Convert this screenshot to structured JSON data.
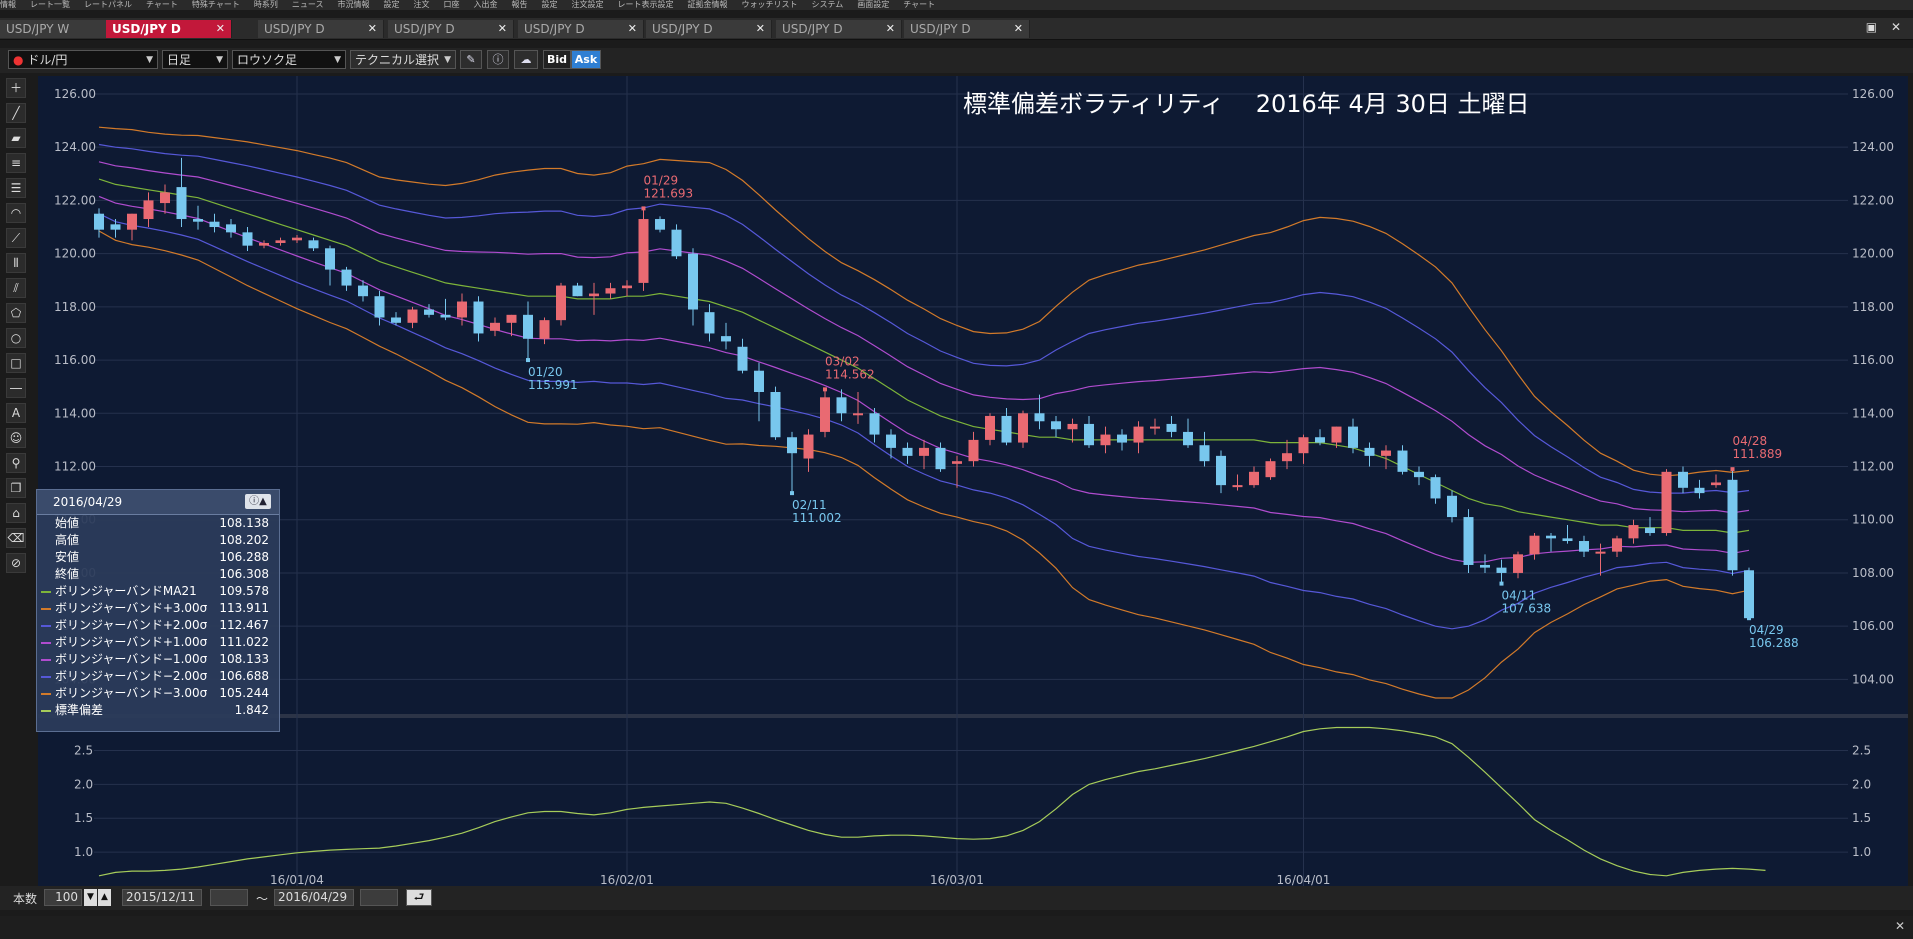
{
  "menubar": {
    "items": [
      "情報",
      "レート一覧",
      "レートパネル",
      "チャート",
      "特殊チャート",
      "時系列",
      "ニュース",
      "市況情報",
      "設定",
      "注文",
      "口座",
      "入出金",
      "報告",
      "設定",
      "注文設定",
      "レート表示設定",
      "証拠金情報",
      "ウォッチリスト",
      "システム",
      "画面設定",
      "チャート"
    ]
  },
  "tabs": [
    {
      "label": "USD/JPY W",
      "active": false
    },
    {
      "label": "USD/JPY D",
      "active": true
    },
    {
      "label": "USD/JPY D",
      "active": false
    },
    {
      "label": "USD/JPY D",
      "active": false
    },
    {
      "label": "USD/JPY D",
      "active": false
    },
    {
      "label": "USD/JPY D",
      "active": false
    },
    {
      "label": "USD/JPY D",
      "active": false
    },
    {
      "label": "USD/JPY D",
      "active": false
    }
  ],
  "toolbar": {
    "pair": "ドル/円",
    "period": "日足",
    "chart_type": "ロウソク足",
    "technical": "テクニカル選択",
    "bid": "Bid",
    "ask": "Ask"
  },
  "colors": {
    "up": "#e96a72",
    "down": "#78c7ee",
    "ma": "#7db43a",
    "band3": "#d27a2a",
    "band2": "#5658d8",
    "band1": "#b04ccf",
    "sd": "#a6cc5a",
    "bg": "#0e1a33"
  },
  "chart_data": {
    "type": "candlestick",
    "title": "標準偏差ボラティリティ　 2016年 4月 30日 土曜日",
    "y_ticks": [
      "126.00",
      "124.00",
      "122.00",
      "120.00",
      "118.00",
      "116.00",
      "114.00",
      "112.00",
      "110.00",
      "108.00",
      "106.00",
      "104.00"
    ],
    "sub_ticks": [
      "2.5",
      "2.0",
      "1.5",
      "1.0"
    ],
    "x_ticks": [
      "16/01/04",
      "16/02/01",
      "16/03/01",
      "16/04/01"
    ],
    "ohlc": [
      [
        121.5,
        121.7,
        120.6,
        120.9
      ],
      [
        121.1,
        121.3,
        120.6,
        120.9
      ],
      [
        120.9,
        121.5,
        120.5,
        121.5
      ],
      [
        121.3,
        122.3,
        121.0,
        122.0
      ],
      [
        121.9,
        122.6,
        121.5,
        122.3
      ],
      [
        122.5,
        123.6,
        121.0,
        121.3
      ],
      [
        121.3,
        121.8,
        120.9,
        121.2
      ],
      [
        121.2,
        121.5,
        120.8,
        121.0
      ],
      [
        121.1,
        121.3,
        120.6,
        120.8
      ],
      [
        120.8,
        121.0,
        120.1,
        120.3
      ],
      [
        120.3,
        120.5,
        120.2,
        120.4
      ],
      [
        120.4,
        120.6,
        120.3,
        120.5
      ],
      [
        120.5,
        120.7,
        120.4,
        120.6
      ],
      [
        120.5,
        120.6,
        120.1,
        120.2
      ],
      [
        120.2,
        120.3,
        118.8,
        119.4
      ],
      [
        119.4,
        119.5,
        118.6,
        118.8
      ],
      [
        118.8,
        119.0,
        118.2,
        118.4
      ],
      [
        118.4,
        118.6,
        117.3,
        117.6
      ],
      [
        117.6,
        117.8,
        117.3,
        117.4
      ],
      [
        117.4,
        118.0,
        117.2,
        117.9
      ],
      [
        117.9,
        118.1,
        117.6,
        117.7
      ],
      [
        117.7,
        118.3,
        117.5,
        117.6
      ],
      [
        117.6,
        118.5,
        117.3,
        118.2
      ],
      [
        118.2,
        118.4,
        116.7,
        117.0
      ],
      [
        117.1,
        117.6,
        116.9,
        117.4
      ],
      [
        117.4,
        117.7,
        116.9,
        117.7
      ],
      [
        117.7,
        118.2,
        116.0,
        116.8
      ],
      [
        116.8,
        117.6,
        116.6,
        117.5
      ],
      [
        117.5,
        118.9,
        117.3,
        118.8
      ],
      [
        118.8,
        118.9,
        118.4,
        118.4
      ],
      [
        118.4,
        118.9,
        117.7,
        118.5
      ],
      [
        118.5,
        118.9,
        118.3,
        118.7
      ],
      [
        118.7,
        119.0,
        118.4,
        118.8
      ],
      [
        118.9,
        121.7,
        118.6,
        121.3
      ],
      [
        121.3,
        121.4,
        120.8,
        120.9
      ],
      [
        120.9,
        121.1,
        119.8,
        119.9
      ],
      [
        120.0,
        120.2,
        117.3,
        117.9
      ],
      [
        117.8,
        118.1,
        116.7,
        117.0
      ],
      [
        116.9,
        117.4,
        116.4,
        116.7
      ],
      [
        116.5,
        116.8,
        115.5,
        115.6
      ],
      [
        115.6,
        115.9,
        113.7,
        114.8
      ],
      [
        114.8,
        115.0,
        113.0,
        113.1
      ],
      [
        113.1,
        113.3,
        111.0,
        112.5
      ],
      [
        112.3,
        113.4,
        111.8,
        113.2
      ],
      [
        113.3,
        114.9,
        113.1,
        114.6
      ],
      [
        114.6,
        114.9,
        113.7,
        114.0
      ],
      [
        114.0,
        114.8,
        113.6,
        114.0
      ],
      [
        114.0,
        114.2,
        112.9,
        113.2
      ],
      [
        113.2,
        113.4,
        112.3,
        112.7
      ],
      [
        112.7,
        112.9,
        112.1,
        112.4
      ],
      [
        112.4,
        113.0,
        111.9,
        112.7
      ],
      [
        112.7,
        112.9,
        111.8,
        111.9
      ],
      [
        112.1,
        112.4,
        111.2,
        112.2
      ],
      [
        112.2,
        113.3,
        112.0,
        113.0
      ],
      [
        113.0,
        114.0,
        112.8,
        113.9
      ],
      [
        113.9,
        114.2,
        112.8,
        112.9
      ],
      [
        112.9,
        114.1,
        112.7,
        114.0
      ],
      [
        114.0,
        114.7,
        113.4,
        113.7
      ],
      [
        113.7,
        113.9,
        113.1,
        113.4
      ],
      [
        113.4,
        113.8,
        112.9,
        113.6
      ],
      [
        113.6,
        113.9,
        112.7,
        112.8
      ],
      [
        112.8,
        113.5,
        112.5,
        113.2
      ],
      [
        113.2,
        113.4,
        112.6,
        112.9
      ],
      [
        112.9,
        113.7,
        112.5,
        113.5
      ],
      [
        113.5,
        113.8,
        113.2,
        113.5
      ],
      [
        113.6,
        113.9,
        113.1,
        113.3
      ],
      [
        113.3,
        113.8,
        112.7,
        112.8
      ],
      [
        112.8,
        113.3,
        112.0,
        112.2
      ],
      [
        112.4,
        112.6,
        111.0,
        111.3
      ],
      [
        111.3,
        111.7,
        111.1,
        111.3
      ],
      [
        111.3,
        112.0,
        111.2,
        111.8
      ],
      [
        111.6,
        112.3,
        111.5,
        112.2
      ],
      [
        112.2,
        113.0,
        111.9,
        112.5
      ],
      [
        112.5,
        113.2,
        112.1,
        113.1
      ],
      [
        113.1,
        113.4,
        112.8,
        112.9
      ],
      [
        112.9,
        113.5,
        112.7,
        113.5
      ],
      [
        113.5,
        113.8,
        112.5,
        112.7
      ],
      [
        112.7,
        112.9,
        112.0,
        112.4
      ],
      [
        112.4,
        112.8,
        111.9,
        112.6
      ],
      [
        112.6,
        112.8,
        111.7,
        111.8
      ],
      [
        111.8,
        112.0,
        111.3,
        111.6
      ],
      [
        111.6,
        111.7,
        110.6,
        110.8
      ],
      [
        110.9,
        111.1,
        109.9,
        110.1
      ],
      [
        110.1,
        110.4,
        108.0,
        108.3
      ],
      [
        108.3,
        108.7,
        108.0,
        108.2
      ],
      [
        108.2,
        108.5,
        107.6,
        108.0
      ],
      [
        108.0,
        108.8,
        107.8,
        108.7
      ],
      [
        108.7,
        109.5,
        108.5,
        109.4
      ],
      [
        109.4,
        109.5,
        108.8,
        109.3
      ],
      [
        109.3,
        109.8,
        109.1,
        109.2
      ],
      [
        109.2,
        109.4,
        108.6,
        108.8
      ],
      [
        108.8,
        109.1,
        107.9,
        108.8
      ],
      [
        108.8,
        109.4,
        108.6,
        109.3
      ],
      [
        109.3,
        110.0,
        109.1,
        109.8
      ],
      [
        109.7,
        110.1,
        109.4,
        109.5
      ],
      [
        109.5,
        111.9,
        109.4,
        111.8
      ],
      [
        111.8,
        112.0,
        111.0,
        111.2
      ],
      [
        111.2,
        111.5,
        110.8,
        111.0
      ],
      [
        111.3,
        111.7,
        111.2,
        111.4
      ],
      [
        111.5,
        111.9,
        107.9,
        108.1
      ],
      [
        108.1,
        108.2,
        106.3,
        106.3
      ]
    ],
    "ma21": [
      122.8,
      122.6,
      122.5,
      122.4,
      122.3,
      122.2,
      122.1,
      121.9,
      121.7,
      121.5,
      121.3,
      121.1,
      120.9,
      120.7,
      120.5,
      120.3,
      120.0,
      119.7,
      119.5,
      119.3,
      119.1,
      118.9,
      118.8,
      118.7,
      118.6,
      118.5,
      118.4,
      118.4,
      118.4,
      118.3,
      118.3,
      118.3,
      118.4,
      118.4,
      118.5,
      118.4,
      118.3,
      118.2,
      118.0,
      117.8,
      117.5,
      117.2,
      116.9,
      116.6,
      116.3,
      116.0,
      115.7,
      115.3,
      114.9,
      114.5,
      114.2,
      113.9,
      113.7,
      113.5,
      113.4,
      113.3,
      113.2,
      113.1,
      113.1,
      113.0,
      113.0,
      113.0,
      113.0,
      113.0,
      113.0,
      113.0,
      113.0,
      113.0,
      113.0,
      113.0,
      113.0,
      112.9,
      112.9,
      112.9,
      112.9,
      112.8,
      112.7,
      112.5,
      112.3,
      112.0,
      111.7,
      111.4,
      111.1,
      110.8,
      110.6,
      110.5,
      110.3,
      110.2,
      110.1,
      110.0,
      109.9,
      109.8,
      109.8,
      109.7,
      109.7,
      109.7,
      109.6,
      109.6,
      109.6,
      109.5,
      109.6
    ],
    "sd": [
      0.65,
      0.7,
      0.72,
      0.72,
      0.73,
      0.75,
      0.78,
      0.82,
      0.86,
      0.9,
      0.93,
      0.96,
      0.99,
      1.01,
      1.03,
      1.04,
      1.05,
      1.06,
      1.09,
      1.13,
      1.17,
      1.22,
      1.28,
      1.36,
      1.45,
      1.52,
      1.58,
      1.6,
      1.6,
      1.57,
      1.55,
      1.58,
      1.63,
      1.66,
      1.68,
      1.7,
      1.72,
      1.74,
      1.72,
      1.65,
      1.57,
      1.48,
      1.4,
      1.32,
      1.26,
      1.22,
      1.22,
      1.24,
      1.25,
      1.25,
      1.24,
      1.22,
      1.2,
      1.19,
      1.2,
      1.24,
      1.32,
      1.45,
      1.64,
      1.85,
      2.0,
      2.07,
      2.13,
      2.19,
      2.23,
      2.28,
      2.33,
      2.38,
      2.44,
      2.5,
      2.56,
      2.63,
      2.7,
      2.78,
      2.82,
      2.84,
      2.84,
      2.84,
      2.82,
      2.79,
      2.75,
      2.7,
      2.6,
      2.4,
      2.18,
      1.95,
      1.72,
      1.48,
      1.32,
      1.18,
      1.03,
      0.9,
      0.8,
      0.72,
      0.67,
      0.65,
      0.7,
      0.73,
      0.75,
      0.76,
      0.75,
      0.73
    ],
    "annotations": [
      {
        "idx": 33,
        "date": "01/29",
        "price": "121.693",
        "pos": "high"
      },
      {
        "idx": 26,
        "date": "01/20",
        "price": "115.991",
        "pos": "low"
      },
      {
        "idx": 44,
        "date": "03/02",
        "price": "114.562",
        "pos": "high"
      },
      {
        "idx": 42,
        "date": "02/11",
        "price": "111.002",
        "pos": "low"
      },
      {
        "idx": 85,
        "date": "04/11",
        "price": "107.638",
        "pos": "low"
      },
      {
        "idx": 99,
        "date": "04/28",
        "price": "111.889",
        "pos": "high"
      },
      {
        "idx": 100,
        "date": "04/29",
        "price": "106.288",
        "pos": "low"
      }
    ]
  },
  "info": {
    "date": "2016/04/29",
    "rows": [
      {
        "label": "始値",
        "value": "108.138",
        "color": ""
      },
      {
        "label": "高値",
        "value": "108.202",
        "color": ""
      },
      {
        "label": "安値",
        "value": "106.288",
        "color": ""
      },
      {
        "label": "終値",
        "value": "106.308",
        "color": ""
      },
      {
        "label": "ボリンジャーバンドMA21",
        "value": "109.578",
        "color": "#7db43a"
      },
      {
        "label": "ボリンジャーバンド+3.00σ",
        "value": "113.911",
        "color": "#d27a2a"
      },
      {
        "label": "ボリンジャーバンド+2.00σ",
        "value": "112.467",
        "color": "#5658d8"
      },
      {
        "label": "ボリンジャーバンド+1.00σ",
        "value": "111.022",
        "color": "#b04ccf"
      },
      {
        "label": "ボリンジャーバンド−1.00σ",
        "value": "108.133",
        "color": "#b04ccf"
      },
      {
        "label": "ボリンジャーバンド−2.00σ",
        "value": "106.688",
        "color": "#5658d8"
      },
      {
        "label": "ボリンジャーバンド−3.00σ",
        "value": "105.244",
        "color": "#d27a2a"
      },
      {
        "label": "標準偏差",
        "value": "1.842",
        "color": "#a6cc5a"
      }
    ]
  },
  "status": {
    "count_label": "本数",
    "count": "100",
    "start": "2015/12/11",
    "tilde": "〜",
    "end": "2016/04/29"
  }
}
